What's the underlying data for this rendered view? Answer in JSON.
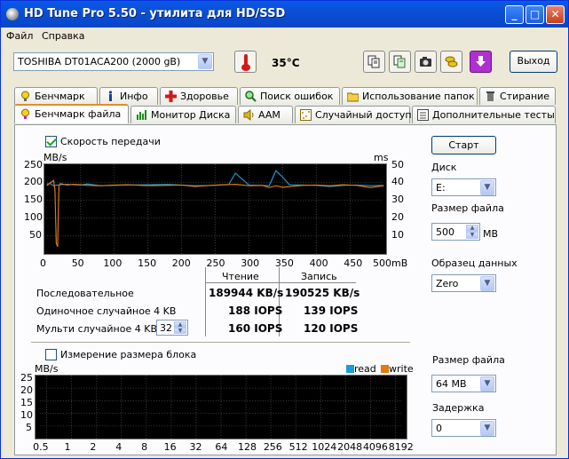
{
  "window": {
    "title": "HD Tune Pro 5.50 - утилита для HD/SSD"
  },
  "menu": {
    "file": "Файл",
    "help": "Справка"
  },
  "toolbar": {
    "drive": "TOSHIBA DT01ACA200 (2000 gB)",
    "temperature": "35°C",
    "exit_label": "Выход",
    "icons": [
      "copy-icon",
      "copy-all-icon",
      "camera-icon",
      "coins-icon",
      "download-icon"
    ]
  },
  "tabs_top": [
    {
      "label": "Бенчмарк",
      "icon": "benchmark-icon"
    },
    {
      "label": "Инфо",
      "icon": "info-icon"
    },
    {
      "label": "Здоровье",
      "icon": "health-icon"
    },
    {
      "label": "Поиск ошибок",
      "icon": "error-scan-icon"
    },
    {
      "label": "Использование папок",
      "icon": "folder-icon"
    },
    {
      "label": "Стирание",
      "icon": "erase-icon"
    }
  ],
  "tabs_bottom": [
    {
      "label": "Бенчмарк файла",
      "icon": "file-benchmark-icon",
      "active": true
    },
    {
      "label": "Монитор Диска",
      "icon": "disk-monitor-icon"
    },
    {
      "label": "AAM",
      "icon": "speaker-icon"
    },
    {
      "label": "Случайный доступ",
      "icon": "random-access-icon"
    },
    {
      "label": "Дополнительные тесты",
      "icon": "extra-tests-icon"
    }
  ],
  "transfer": {
    "checkbox_label": "Скорость передачи",
    "checked": true,
    "y_left_unit": "MB/s",
    "y_right_unit": "ms",
    "y_left_ticks": [
      "250",
      "200",
      "150",
      "100",
      "50"
    ],
    "y_right_ticks": [
      "50",
      "40",
      "30",
      "20",
      "10"
    ],
    "x_ticks": [
      "0",
      "50",
      "100",
      "150",
      "200",
      "250",
      "300",
      "350",
      "400",
      "450",
      "500mB"
    ]
  },
  "results": {
    "col_read": "Чтение",
    "col_write": "Запись",
    "rows": [
      {
        "label": "Последовательное",
        "read": "189944 KB/s",
        "write": "190525 KB/s"
      },
      {
        "label": "Одиночное случайное 4 KB",
        "read": "188 IOPS",
        "write": "139 IOPS"
      },
      {
        "label": "Мульти случайное 4 KB",
        "read": "160 IOPS",
        "write": "120 IOPS",
        "queue": "32"
      }
    ]
  },
  "right_panel": {
    "start_label": "Старт",
    "disk_label": "Диск",
    "disk_value": "E:",
    "file_size_label": "Размер файла",
    "file_size_value": "500",
    "file_size_unit": "MB",
    "pattern_label": "Образец данных",
    "pattern_value": "Zero"
  },
  "block": {
    "checkbox_label": "Измерение размера блока",
    "checked": false,
    "y_unit": "MB/s",
    "y_ticks": [
      "25",
      "20",
      "15",
      "10",
      "5"
    ],
    "legend_read": "read",
    "legend_write": "write",
    "x_ticks": [
      "0.5",
      "1",
      "2",
      "4",
      "8",
      "16",
      "32",
      "64",
      "128",
      "256",
      "512",
      "1024",
      "2048",
      "4096",
      "8192"
    ],
    "file_size_label": "Размер файла",
    "file_size_value": "64 MB",
    "delay_label": "Задержка",
    "delay_value": "0"
  },
  "colors": {
    "read": "#1e9bd6",
    "write": "#e07b12",
    "graph_bg": "#000000",
    "title_bar": "#0a58e8"
  },
  "chart_data": {
    "type": "line",
    "x_range": [
      0,
      500
    ],
    "ylim_left": [
      0,
      250
    ],
    "ylim_right": [
      0,
      50
    ],
    "x_unit": "mB",
    "series": [
      {
        "name": "read",
        "x": [
          0,
          5,
          10,
          15,
          20,
          30,
          40,
          50,
          60,
          80,
          100,
          120,
          150,
          180,
          200,
          220,
          250,
          270,
          280,
          300,
          320,
          330,
          340,
          350,
          360,
          380,
          400,
          420,
          440,
          460,
          480,
          500
        ],
        "y": [
          195,
          196,
          190,
          192,
          193,
          194,
          193,
          192,
          195,
          190,
          191,
          192,
          193,
          194,
          192,
          190,
          191,
          194,
          225,
          192,
          191,
          190,
          232,
          214,
          193,
          192,
          191,
          188,
          191,
          192,
          190,
          191
        ]
      },
      {
        "name": "write",
        "x": [
          0,
          5,
          10,
          12,
          14,
          16,
          18,
          20,
          30,
          40,
          50,
          60,
          80,
          100,
          120,
          150,
          180,
          200,
          220,
          250,
          280,
          300,
          320,
          330,
          340,
          350,
          380,
          400,
          420,
          440,
          460,
          480,
          500
        ],
        "y": [
          190,
          198,
          205,
          180,
          30,
          20,
          190,
          196,
          192,
          194,
          193,
          191,
          190,
          192,
          193,
          190,
          191,
          192,
          188,
          192,
          194,
          190,
          191,
          185,
          190,
          186,
          191,
          192,
          190,
          193,
          191,
          185,
          190
        ]
      }
    ]
  }
}
